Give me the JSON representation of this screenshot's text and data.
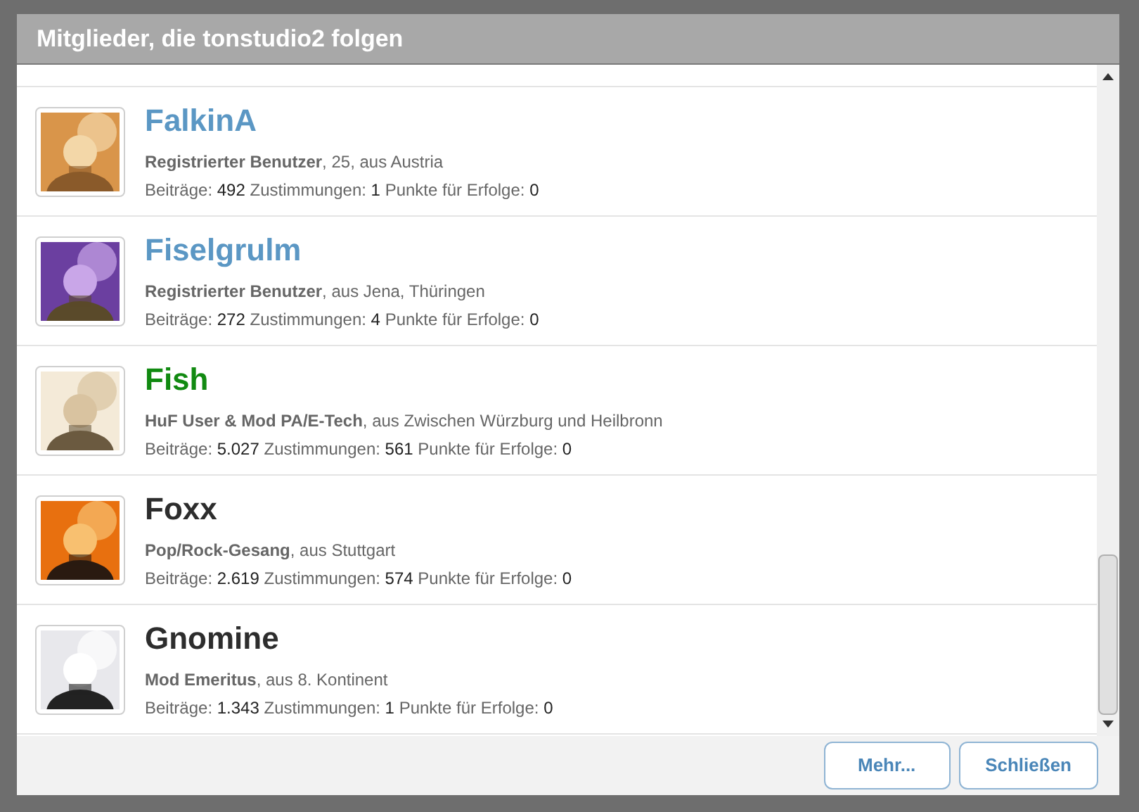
{
  "dialog": {
    "title": "Mitglieder, die tonstudio2 folgen"
  },
  "members": [
    {
      "name": "FalkinA",
      "color": "#5b97c4",
      "info": "**Registrierter Benutzer**, 25, aus Austria",
      "stats": [
        {
          "label": "Beiträge:",
          "value": "492"
        },
        {
          "label": "Zustimmungen:",
          "value": "1"
        },
        {
          "label": "Punkte für Erfolge:",
          "value": "0"
        }
      ]
    },
    {
      "name": "Fiselgrulm",
      "color": "#5b97c4",
      "info": "**Registrierter Benutzer**, aus Jena, Thüringen",
      "stats": [
        {
          "label": "Beiträge:",
          "value": "272"
        },
        {
          "label": "Zustimmungen:",
          "value": "4"
        },
        {
          "label": "Punkte für Erfolge:",
          "value": "0"
        }
      ]
    },
    {
      "name": "Fish",
      "color": "#118a11",
      "info": "**HuF User & Mod PA/E-Tech**, aus Zwischen Würzburg und Heilbronn",
      "stats": [
        {
          "label": "Beiträge:",
          "value": "5.027"
        },
        {
          "label": "Zustimmungen:",
          "value": "561"
        },
        {
          "label": "Punkte für Erfolge:",
          "value": "0"
        }
      ]
    },
    {
      "name": "Foxx",
      "color": "#2d2d2d",
      "info": "**Pop/Rock-Gesang**, aus Stuttgart",
      "stats": [
        {
          "label": "Beiträge:",
          "value": "2.619"
        },
        {
          "label": "Zustimmungen:",
          "value": "574"
        },
        {
          "label": "Punkte für Erfolge:",
          "value": "0"
        }
      ]
    },
    {
      "name": "Gnomine",
      "color": "#2d2d2d",
      "info": "**Mod Emeritus**, aus 8. Kontinent",
      "stats": [
        {
          "label": "Beiträge:",
          "value": "1.343"
        },
        {
          "label": "Zustimmungen:",
          "value": "1"
        },
        {
          "label": "Punkte für Erfolge:",
          "value": "0"
        }
      ]
    }
  ],
  "buttons": [
    "Mehr...",
    "Schließen"
  ]
}
